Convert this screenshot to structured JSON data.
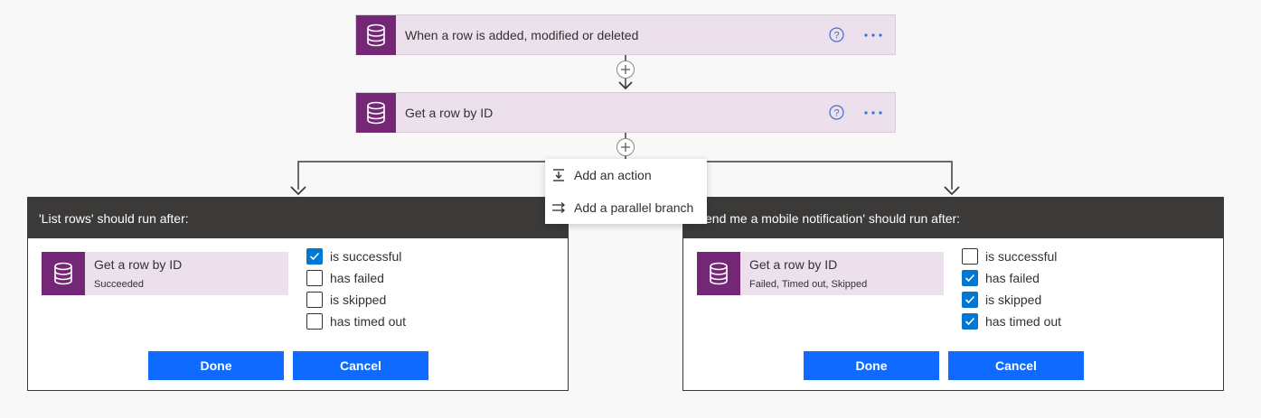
{
  "flow": {
    "trigger": {
      "title": "When a row is added, modified or deleted",
      "icon": "database-icon"
    },
    "action": {
      "title": "Get a row by ID",
      "icon": "database-icon"
    }
  },
  "add_menu": {
    "items": [
      {
        "label": "Add an action",
        "icon": "add-action-icon"
      },
      {
        "label": "Add a parallel branch",
        "icon": "parallel-branch-icon"
      }
    ]
  },
  "panels": [
    {
      "header": "'List rows' should run after:",
      "source_title": "Get a row by ID",
      "source_status": "Succeeded",
      "checks": [
        {
          "label": "is successful",
          "checked": true
        },
        {
          "label": "has failed",
          "checked": false
        },
        {
          "label": "is skipped",
          "checked": false
        },
        {
          "label": "has timed out",
          "checked": false
        }
      ],
      "done_label": "Done",
      "cancel_label": "Cancel"
    },
    {
      "header": "'Send me a mobile notification' should run after:",
      "source_title": "Get a row by ID",
      "source_status": "Failed, Timed out, Skipped",
      "checks": [
        {
          "label": "is successful",
          "checked": false
        },
        {
          "label": "has failed",
          "checked": true
        },
        {
          "label": "is skipped",
          "checked": true
        },
        {
          "label": "has timed out",
          "checked": true
        }
      ],
      "done_label": "Done",
      "cancel_label": "Cancel"
    }
  ],
  "colors": {
    "connector_accent": "#742774",
    "button_blue": "#0f6bff",
    "header_dark": "#3b3a39",
    "card_bg": "#ebe0ec",
    "link_blue": "#3b6fd6"
  }
}
